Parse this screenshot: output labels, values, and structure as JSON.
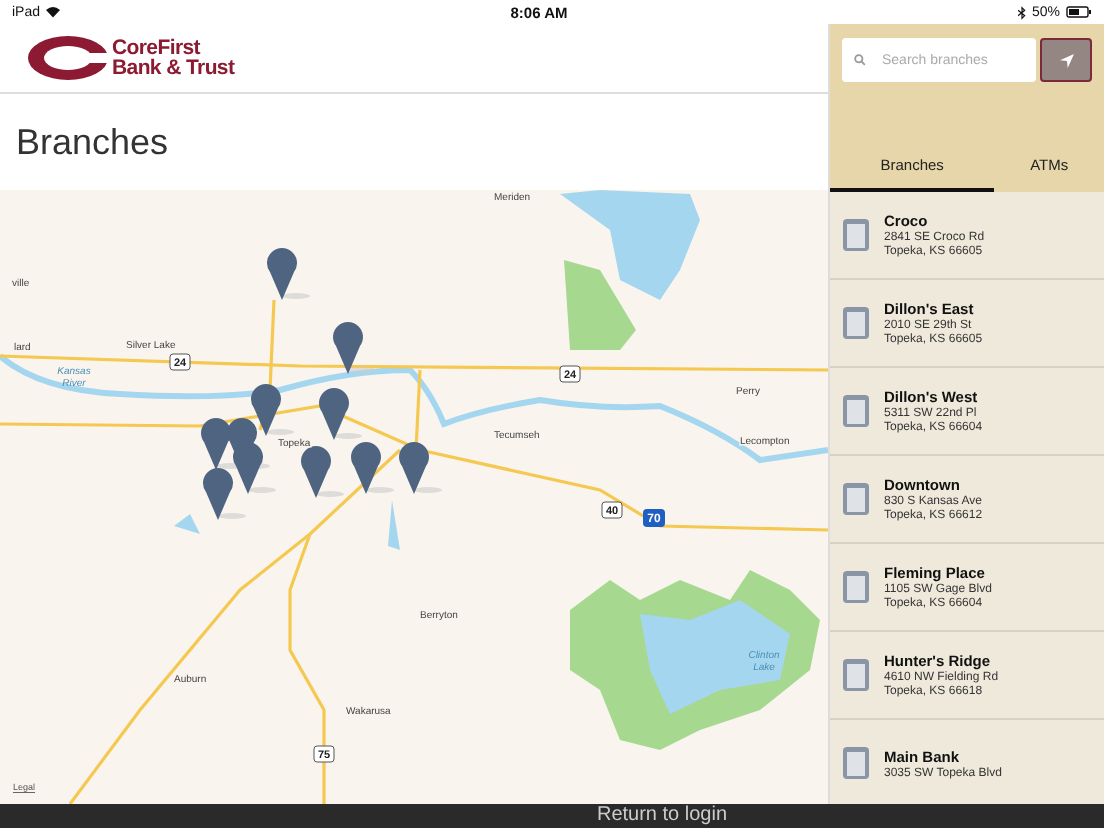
{
  "status_bar": {
    "device": "iPad",
    "time": "8:06 AM",
    "battery": "50%"
  },
  "logo": {
    "line_1": "CoreFirst",
    "line_2": "Bank & Trust"
  },
  "title": "Branches",
  "map": {
    "labels": [
      {
        "kind": "place",
        "text": "Meriden"
      },
      {
        "kind": "place",
        "text": "ville"
      },
      {
        "kind": "place",
        "text": "lard"
      },
      {
        "kind": "place",
        "text": "Silver Lake"
      },
      {
        "kind": "water",
        "text": "Kansas"
      },
      {
        "kind": "water",
        "text": "River"
      },
      {
        "kind": "shield",
        "text": "24"
      },
      {
        "kind": "shield",
        "text": "24"
      },
      {
        "kind": "place",
        "text": "Perry"
      },
      {
        "kind": "place",
        "text": "Tecumseh"
      },
      {
        "kind": "place",
        "text": "Topeka"
      },
      {
        "kind": "place",
        "text": "Lecompton"
      },
      {
        "kind": "shield",
        "text": "40"
      },
      {
        "kind": "interstate",
        "text": "70"
      },
      {
        "kind": "place",
        "text": "Berryton"
      },
      {
        "kind": "water",
        "text": "Clinton"
      },
      {
        "kind": "water",
        "text": "Lake"
      },
      {
        "kind": "place",
        "text": "Auburn"
      },
      {
        "kind": "place",
        "text": "Wakarusa"
      },
      {
        "kind": "shield",
        "text": "75"
      },
      {
        "kind": "legal",
        "text": "Legal"
      }
    ]
  },
  "search": {
    "placeholder": "Search branches"
  },
  "tabs": [
    {
      "label": "Branches",
      "selected": true
    },
    {
      "label": "ATMs",
      "selected": false
    }
  ],
  "branches": [
    {
      "name": "Croco",
      "address_lines": [
        "2841 SE Croco Rd",
        "Topeka, KS 66605"
      ]
    },
    {
      "name": "Dillon's East",
      "address_lines": [
        "2010 SE 29th St",
        "Topeka, KS 66605"
      ]
    },
    {
      "name": "Dillon's West",
      "address_lines": [
        "5311 SW 22nd Pl",
        "Topeka, KS 66604"
      ]
    },
    {
      "name": "Downtown",
      "address_lines": [
        "830 S Kansas Ave",
        "Topeka, KS 66612"
      ]
    },
    {
      "name": "Fleming Place",
      "address_lines": [
        "1105 SW Gage Blvd",
        "Topeka, KS 66604"
      ]
    },
    {
      "name": "Hunter's Ridge",
      "address_lines": [
        "4610 NW Fielding Rd",
        "Topeka, KS 66618"
      ]
    },
    {
      "name": "Main Bank",
      "address_lines": [
        "3035 SW Topeka Blvd"
      ]
    }
  ],
  "footer": {
    "link": "Return to login"
  }
}
